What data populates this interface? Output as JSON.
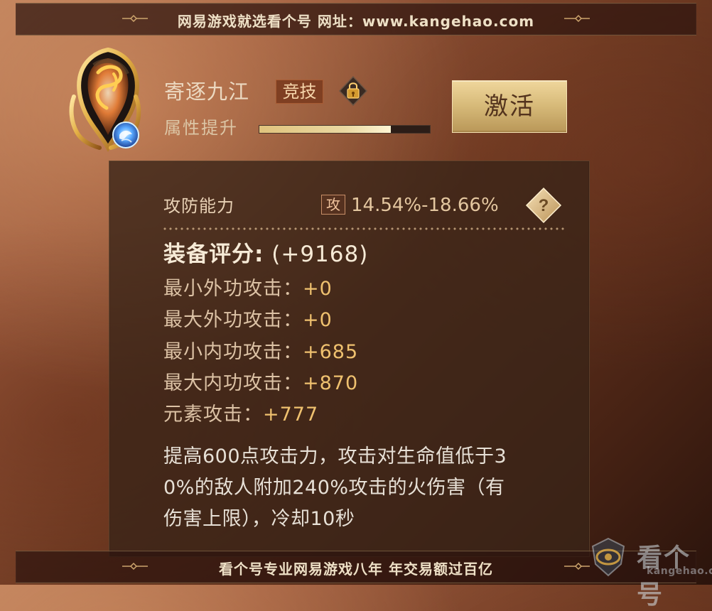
{
  "top_banner": {
    "text": "网易游戏就选看个号  网址：www.kangehao.com"
  },
  "item": {
    "name": "寄逐九江",
    "badge": "竞技",
    "attribute_label": "属性提升",
    "attribute_progress_percent": 77,
    "activate_label": "激活",
    "icon_name": "flame-rune-icon"
  },
  "stats": {
    "section_label": "攻防能力",
    "attack_glyph": "攻",
    "range": "14.54%-18.66%",
    "help_icon_name": "question-icon",
    "score_label": "装备评分:",
    "score_value": "(+9168)"
  },
  "attributes": [
    {
      "name": "最小外功攻击",
      "value": "+0"
    },
    {
      "name": "最大外功攻击",
      "value": "+0"
    },
    {
      "name": "最小内功攻击",
      "value": "+685"
    },
    {
      "name": "最大内功攻击",
      "value": "+870"
    },
    {
      "name": "元素攻击",
      "value": "+777"
    }
  ],
  "description": {
    "line1": "提高600点攻击力，攻击对生命值低于3",
    "line2": "0%的敌人附加240%攻击的火伤害（有",
    "line3": "伤害上限），冷却10秒"
  },
  "bottom_banner": {
    "text": "看个号专业网易游戏八年  年交易额过百亿"
  },
  "watermark": {
    "title": "看个号",
    "subtitle": "kangehao.com",
    "icon_name": "eye-shield-icon"
  }
}
